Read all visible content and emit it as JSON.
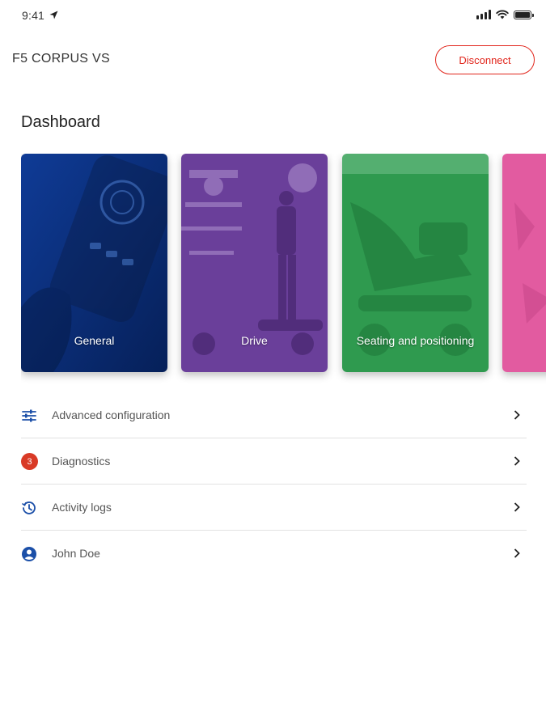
{
  "status_bar": {
    "time": "9:41"
  },
  "header": {
    "device_name": "F5 CORPUS VS",
    "disconnect_label": "Disconnect"
  },
  "dashboard": {
    "title": "Dashboard",
    "cards": [
      {
        "label": "General",
        "color": "#0b2f7a"
      },
      {
        "label": "Drive",
        "color": "#6a3c96"
      },
      {
        "label": "Seating and positioning",
        "color": "#2f9a52"
      },
      {
        "label": "",
        "color": "#e05aa0"
      }
    ]
  },
  "menu": {
    "items": [
      {
        "label": "Advanced configuration",
        "icon": "sliders-icon"
      },
      {
        "label": "Diagnostics",
        "icon": "badge",
        "badge": "3"
      },
      {
        "label": "Activity logs",
        "icon": "history-icon"
      },
      {
        "label": "John Doe",
        "icon": "account-icon"
      }
    ]
  },
  "colors": {
    "accent": "#e1261c",
    "icon_blue": "#1b4fa8",
    "badge_red": "#d93a26"
  }
}
